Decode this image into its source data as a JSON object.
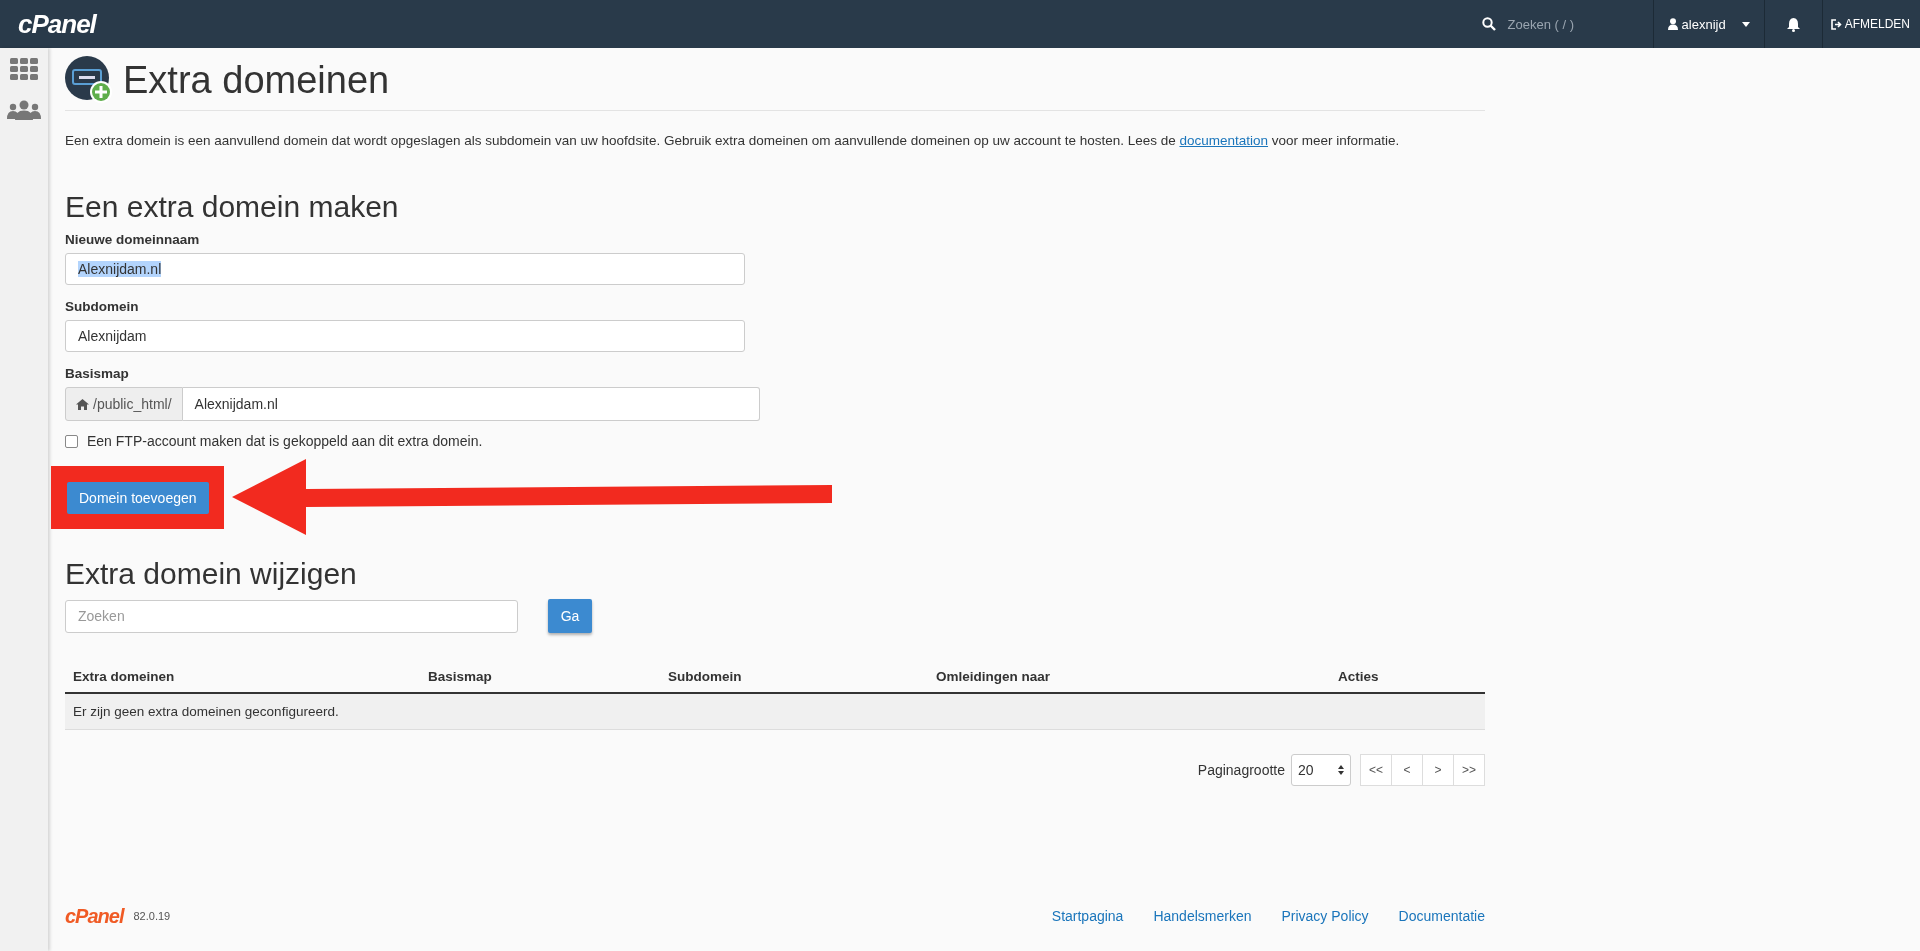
{
  "topbar": {
    "logo": "cPanel",
    "search": {
      "placeholder": "Zoeken ( / )"
    },
    "user": "alexnijd",
    "logout": "AFMELDEN"
  },
  "page": {
    "title": "Extra domeinen",
    "intro": {
      "before": "Een extra domein is een aanvullend domein dat wordt opgeslagen als subdomein van uw hoofdsite. Gebruik extra domeinen om aanvullende domeinen op uw account te hosten. Lees de ",
      "link": "documentation",
      "after": " voor meer informatie."
    }
  },
  "create_form": {
    "heading": "Een extra domein maken",
    "fields": [
      {
        "label": "Nieuwe domeinnaam",
        "value": "Alexnijdam.nl",
        "text_selected": true
      },
      {
        "label": "Subdomein",
        "value": "Alexnijdam",
        "text_selected": false
      },
      {
        "label": "Basismap",
        "prefix": "/public_html/",
        "value": "Alexnijdam.nl",
        "text_selected": false
      }
    ],
    "ftp_checkbox": {
      "label": "Een FTP-account maken dat is gekoppeld aan dit extra domein.",
      "checked": false
    },
    "submit": "Domein toevoegen"
  },
  "manage": {
    "heading": "Extra domein wijzigen",
    "search": {
      "placeholder": "Zoeken"
    },
    "go": "Ga",
    "table": {
      "columns": [
        "Extra domeinen",
        "Basismap",
        "Subdomein",
        "Omleidingen naar",
        "Acties"
      ],
      "empty_message": "Er zijn geen extra domeinen geconfigureerd."
    },
    "pagination": {
      "label": "Paginagrootte",
      "page_size": "20",
      "buttons": [
        "<<",
        "<",
        ">",
        ">>"
      ]
    }
  },
  "footer": {
    "logo": "cPanel",
    "version": "82.0.19",
    "links": [
      "Startpagina",
      "Handelsmerken",
      "Privacy Policy",
      "Documentatie"
    ]
  }
}
